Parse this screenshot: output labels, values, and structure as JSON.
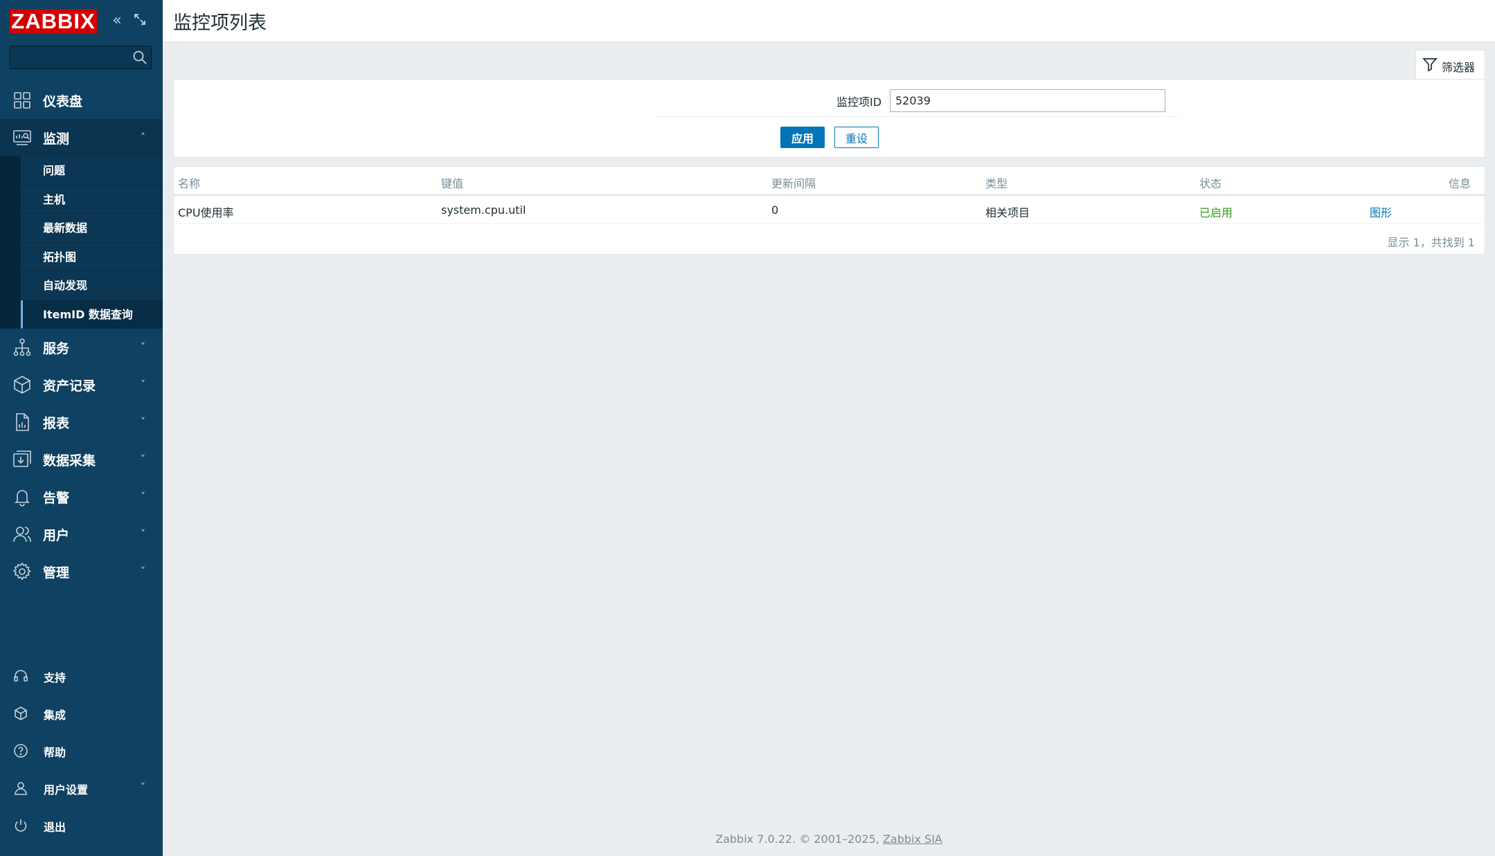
{
  "app": {
    "logo_text": "ZABBIX",
    "brand_color": "#d40000",
    "sidebar_color": "#0e4162",
    "accent_color": "#0275b8"
  },
  "sidebar": {
    "search_placeholder": "",
    "menu": [
      {
        "label": "仪表盘",
        "icon": "dashboard-icon",
        "expanded": false
      },
      {
        "label": "监测",
        "icon": "monitoring-icon",
        "expanded": true,
        "children": [
          "问题",
          "主机",
          "最新数据",
          "拓扑图",
          "自动发现",
          "ItemID 数据查询"
        ],
        "active_child": "ItemID 数据查询"
      },
      {
        "label": "服务",
        "icon": "services-icon",
        "expanded": false
      },
      {
        "label": "资产记录",
        "icon": "inventory-icon",
        "expanded": false
      },
      {
        "label": "报表",
        "icon": "reports-icon",
        "expanded": false
      },
      {
        "label": "数据采集",
        "icon": "data-collection-icon",
        "expanded": false
      },
      {
        "label": "告警",
        "icon": "alerts-icon",
        "expanded": false
      },
      {
        "label": "用户",
        "icon": "users-icon",
        "expanded": false
      },
      {
        "label": "管理",
        "icon": "administration-icon",
        "expanded": false
      }
    ],
    "bottom": [
      {
        "label": "支持",
        "icon": "headset-icon"
      },
      {
        "label": "集成",
        "icon": "integrations-icon"
      },
      {
        "label": "帮助",
        "icon": "help-icon"
      },
      {
        "label": "用户设置",
        "icon": "user-settings-icon"
      },
      {
        "label": "退出",
        "icon": "power-icon"
      }
    ]
  },
  "header": {
    "title": "监控项列表"
  },
  "filter": {
    "tab_label": "筛选器",
    "field_label": "监控项ID",
    "field_value": "52039",
    "apply_label": "应用",
    "reset_label": "重设"
  },
  "table": {
    "columns": [
      "名称",
      "键值",
      "更新间隔",
      "类型",
      "状态",
      "信息"
    ],
    "rows": [
      {
        "name": "CPU使用率",
        "key": "system.cpu.util",
        "interval": "0",
        "type": "相关项目",
        "status": "已启用",
        "info": "图形"
      }
    ],
    "status_color": "#2f9f19",
    "footer_text": "显示 1，共找到 1"
  },
  "footer": {
    "text": "Zabbix 7.0.22. © 2001–2025, ",
    "link": "Zabbix SIA"
  }
}
